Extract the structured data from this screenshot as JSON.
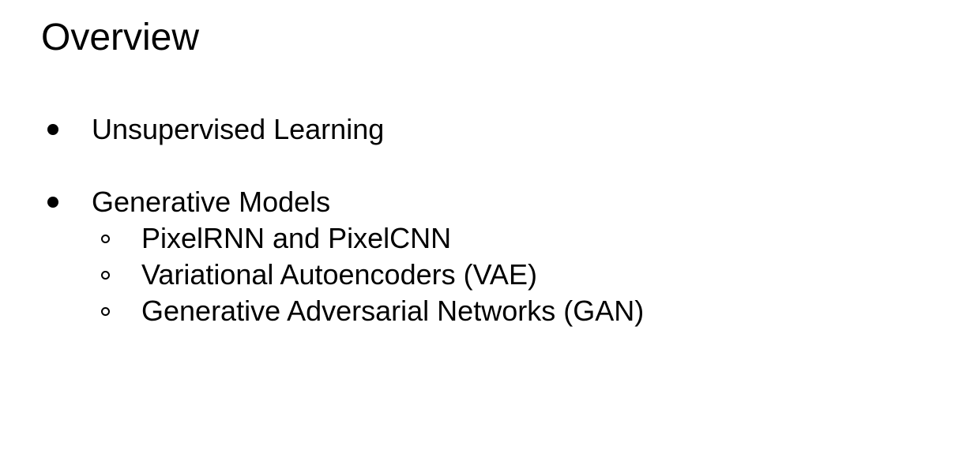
{
  "slide": {
    "title": "Overview",
    "bullets": [
      {
        "text": "Unsupervised Learning",
        "subitems": []
      },
      {
        "text": "Generative Models",
        "subitems": [
          "PixelRNN and PixelCNN",
          "Variational Autoencoders (VAE)",
          "Generative Adversarial Networks (GAN)"
        ]
      }
    ]
  }
}
